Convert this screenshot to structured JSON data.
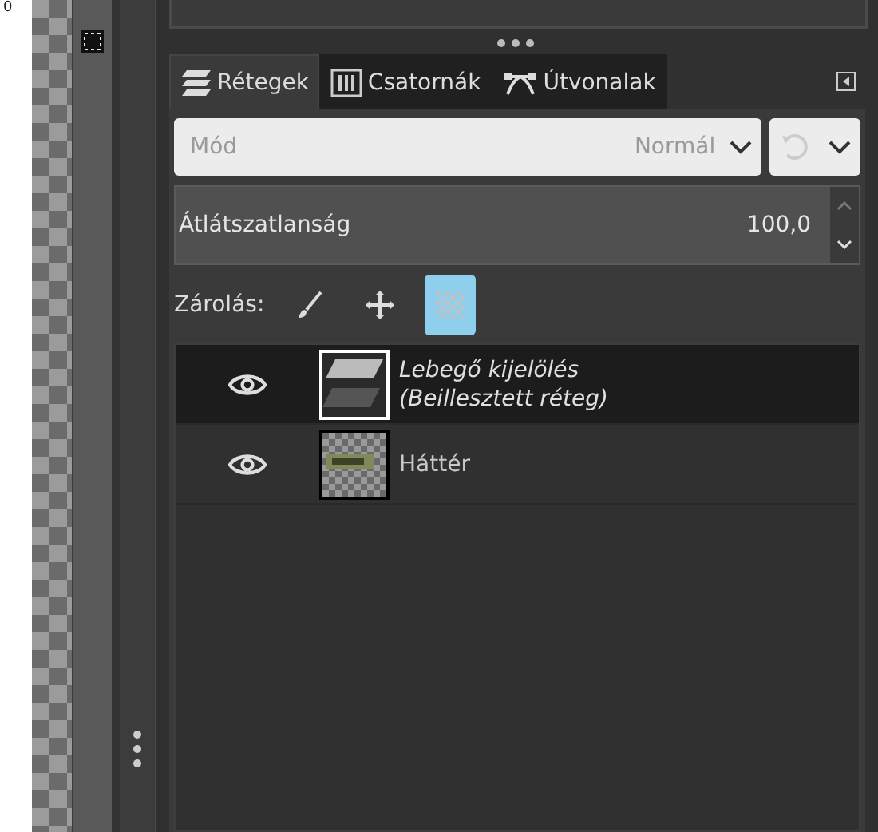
{
  "ruler": {
    "label": "0"
  },
  "tabs": [
    {
      "label": "Rétegek",
      "kind": "layers",
      "selected": true
    },
    {
      "label": "Csatornák",
      "kind": "channels",
      "selected": false
    },
    {
      "label": "Útvonalak",
      "kind": "paths",
      "selected": false
    }
  ],
  "mode": {
    "placeholder": "Mód",
    "value": "Normál"
  },
  "opacity": {
    "label": "Átlátszatlanság",
    "value": "100,0"
  },
  "lock": {
    "label": "Zárolás:",
    "items": [
      {
        "kind": "pixels",
        "on": false
      },
      {
        "kind": "position",
        "on": false
      },
      {
        "kind": "alpha",
        "on": true
      }
    ]
  },
  "layers": [
    {
      "name": "Lebegő kijelölés\n(Beillesztett réteg)",
      "floating": true,
      "visible": true,
      "selected": true
    },
    {
      "name": "Háttér",
      "floating": false,
      "visible": true,
      "selected": false
    }
  ]
}
